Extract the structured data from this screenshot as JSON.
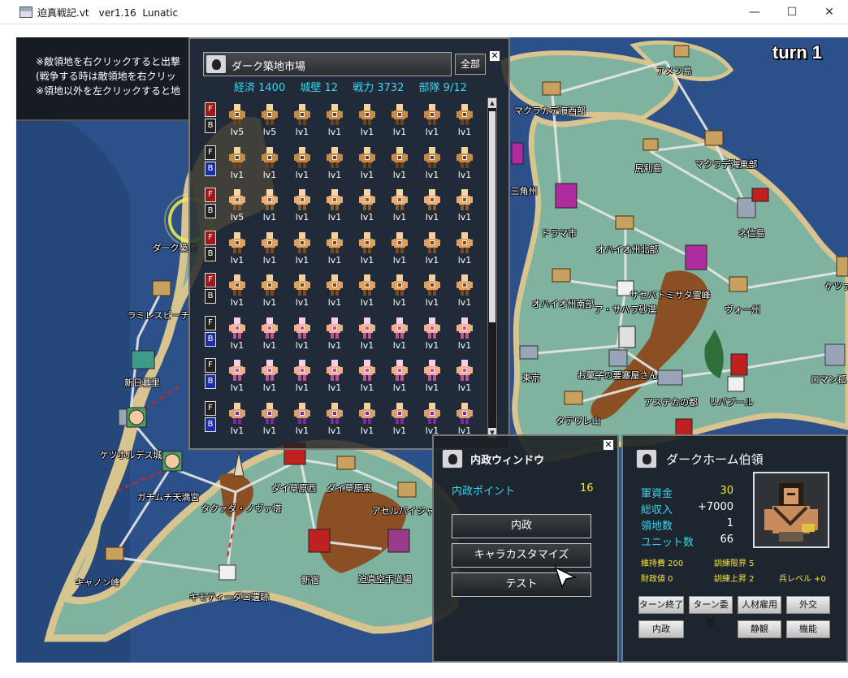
{
  "window": {
    "title": "迫真戦記.vt　ver1.16  Lunatic",
    "minimize_glyph": "—",
    "maximize_glyph": "☐",
    "close_glyph": "✕"
  },
  "game": {
    "turn_label": "turn 1",
    "instructions": [
      "※敵領地を右クリックすると出撃",
      "(戦争する時は敵領地を右クリッ",
      "※領地以外を左クリックすると地"
    ],
    "towns": [
      "アメフ島",
      "マクラカデ海西部",
      "尻利島",
      "マクラデ海東部",
      "ネ信島",
      "三角州",
      "ドラマ市",
      "オハイオ州北部",
      "ケツァ",
      "サセバトミサタ霊峰",
      "ア・サハラ砂漠",
      "オハイオ州南部",
      "ヴォー州",
      "ダーク築地",
      "ラミレスビーチ",
      "新日暮里",
      "ケツホルデス城",
      "ガチムチ天満宮",
      "東京",
      "お菓子の要塞屋さん",
      "アステカの都",
      "リバプール",
      "ロマン孤",
      "タテワレ山",
      "タクァダ・ノヴァ塔",
      "ダイ草原西",
      "ダイ草原東",
      "アセルバイジャ",
      "キャノン峰",
      "新宿",
      "迫真空手道場",
      "キモティーダロ遺跡"
    ]
  },
  "unit_panel": {
    "territory_name": "ダーク築地市場",
    "all_button": "全部",
    "close_glyph": "✕",
    "stats": {
      "economy": "経済 1400",
      "wall": "城壁 12",
      "power": "戦力 3732",
      "units": "部隊 9/12"
    },
    "scroll_up": "▲",
    "scroll_down": "▼",
    "rows": [
      {
        "front": true,
        "back": false,
        "kind": "knight-tan",
        "levels": [
          "lv5",
          "lv5",
          "lv1",
          "lv1",
          "lv1",
          "lv1",
          "lv1",
          "lv1"
        ]
      },
      {
        "front": false,
        "back": true,
        "kind": "knight-tan",
        "levels": [
          "lv1",
          "lv1",
          "lv1",
          "lv1",
          "lv1",
          "lv1",
          "lv1",
          "lv1"
        ]
      },
      {
        "front": true,
        "back": false,
        "kind": "brawler",
        "levels": [
          "lv5",
          "lv1",
          "lv1",
          "lv1",
          "lv1",
          "lv1",
          "lv1",
          "lv1"
        ]
      },
      {
        "front": true,
        "back": false,
        "kind": "spearman",
        "levels": [
          "lv1",
          "lv1",
          "lv1",
          "lv1",
          "lv1",
          "lv1",
          "lv1",
          "lv1"
        ]
      },
      {
        "front": true,
        "back": false,
        "kind": "spearman",
        "levels": [
          "lv1",
          "lv1",
          "lv1",
          "lv1",
          "lv1",
          "lv1",
          "lv1",
          "lv1"
        ]
      },
      {
        "front": false,
        "back": true,
        "kind": "pink",
        "levels": [
          "lv1",
          "lv1",
          "lv1",
          "lv1",
          "lv1",
          "lv1",
          "lv1",
          "lv1"
        ]
      },
      {
        "front": false,
        "back": true,
        "kind": "pink",
        "levels": [
          "lv1",
          "lv1",
          "lv1",
          "lv1",
          "lv1",
          "lv1",
          "lv1",
          "lv1"
        ]
      },
      {
        "front": false,
        "back": true,
        "kind": "mage",
        "levels": [
          "lv1",
          "lv1",
          "lv1",
          "lv1",
          "lv1",
          "lv1",
          "lv1",
          "lv1"
        ]
      }
    ]
  },
  "naisei_window": {
    "title": "内政ウィンドウ",
    "close_glyph": "✕",
    "points_label": "内政ポイント",
    "points_value": "16",
    "buttons": [
      "内政",
      "キャラカスタマイズ",
      "テスト"
    ]
  },
  "lord_panel": {
    "name": "ダークホーム伯領",
    "stats": [
      {
        "label": "軍資金",
        "value": "30",
        "gold": true
      },
      {
        "label": "総収入",
        "value": "+7000",
        "gold": false
      },
      {
        "label": "領地数",
        "value": "1",
        "gold": false
      },
      {
        "label": "ユニット数",
        "value": "66",
        "gold": false
      }
    ],
    "extra": {
      "upkeep": "維持費 200",
      "train_limit": "訓練限界 5",
      "finance": "財政値 0",
      "train_up": "訓練上昇 2",
      "soldier_level": "兵レベル +0"
    },
    "buttons": {
      "turn_end": "ターン終了",
      "turn_delegate": "ターン委任",
      "hire": "人材雇用",
      "diplomacy": "外交",
      "domestic": "内政",
      "watch": "静観",
      "function": "機能"
    }
  },
  "colors": {
    "sea": "#2a4f86",
    "land": "#7fb39f",
    "sand": "#d7c48e",
    "mountain": "#8a4f22",
    "cyan_text": "#39d6ee",
    "gold_text": "#f5e442"
  }
}
